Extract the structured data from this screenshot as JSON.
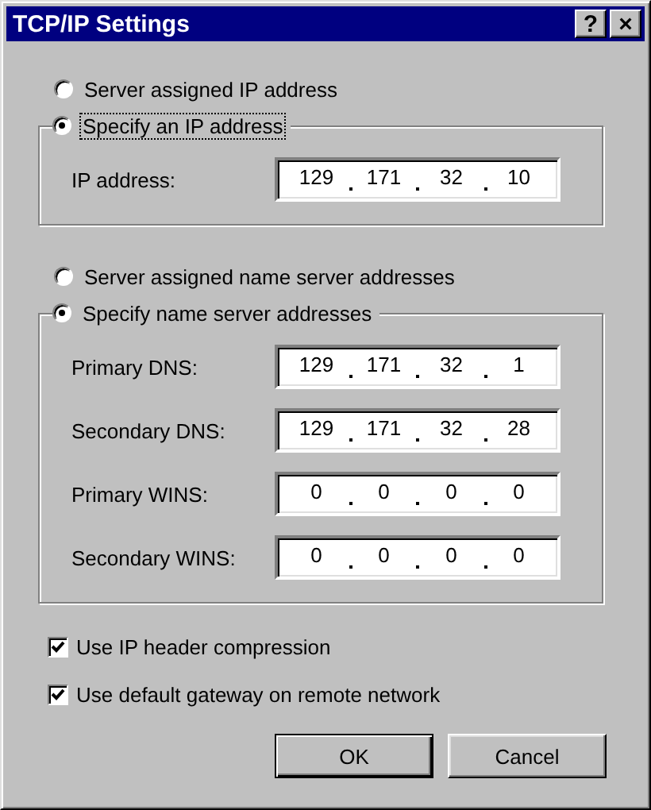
{
  "window": {
    "title": "TCP/IP Settings",
    "title_buttons": [
      "?",
      "×"
    ]
  },
  "ip_section": {
    "radios": [
      {
        "label": "Server assigned IP address",
        "selected": false,
        "focused": false
      },
      {
        "label": "Specify an IP address",
        "selected": true,
        "focused": true
      }
    ],
    "fields": [
      {
        "label": "IP address:",
        "octets": [
          "129",
          "171",
          "32",
          "10"
        ]
      }
    ]
  },
  "name_server_section": {
    "radios": [
      {
        "label": "Server assigned name server addresses",
        "selected": false,
        "focused": false
      },
      {
        "label": "Specify name server addresses",
        "selected": true,
        "focused": false
      }
    ],
    "fields": [
      {
        "label": "Primary DNS:",
        "octets": [
          "129",
          "171",
          "32",
          "1"
        ]
      },
      {
        "label": "Secondary DNS:",
        "octets": [
          "129",
          "171",
          "32",
          "28"
        ]
      },
      {
        "label": "Primary WINS:",
        "octets": [
          "0",
          "0",
          "0",
          "0"
        ]
      },
      {
        "label": "Secondary WINS:",
        "octets": [
          "0",
          "0",
          "0",
          "0"
        ]
      }
    ]
  },
  "options": [
    {
      "label": "Use IP header compression",
      "checked": true
    },
    {
      "label": "Use default gateway on remote network",
      "checked": true
    }
  ],
  "buttons": [
    {
      "label": "OK",
      "default": true
    },
    {
      "label": "Cancel",
      "default": false
    }
  ]
}
